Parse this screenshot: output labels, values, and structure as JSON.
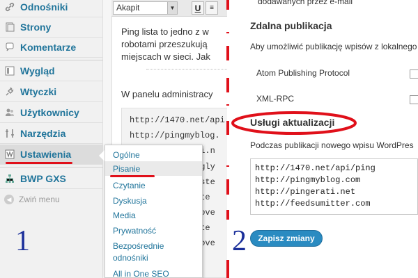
{
  "sidebar": {
    "items": [
      {
        "label": "Odnośniki",
        "icon": "link-icon"
      },
      {
        "label": "Strony",
        "icon": "pages-icon"
      },
      {
        "label": "Komentarze",
        "icon": "comments-icon"
      },
      {
        "label": "Wygląd",
        "icon": "appearance-icon"
      },
      {
        "label": "Wtyczki",
        "icon": "plugins-icon"
      },
      {
        "label": "Użytkownicy",
        "icon": "users-icon"
      },
      {
        "label": "Narzędzia",
        "icon": "tools-icon"
      },
      {
        "label": "Ustawienia",
        "icon": "settings-icon"
      },
      {
        "label": "BWP GXS",
        "icon": "sitemap-icon"
      }
    ],
    "collapse_label": "Zwiń menu"
  },
  "submenu": {
    "items": [
      "Ogólne",
      "Pisanie",
      "Czytanie",
      "Dyskusja",
      "Media",
      "Prywatność",
      "Bezpośrednie",
      "odnośniki",
      "All in One SEO"
    ]
  },
  "editor": {
    "format_value": "Akapit",
    "underline_button": "U",
    "para1": [
      "Ping lista to jedno z w",
      "robotami przeszukują",
      "miejscach w sieci. Jak"
    ],
    "para2": "W panelu administracy",
    "code_lines": [
      "http://1470.net/api",
      "http://pingmyblog.",
      "ti.n",
      "ogly",
      "lste",
      "ste",
      "eove",
      "ste",
      "eove"
    ]
  },
  "settings": {
    "top_text": "dodawanych przez e-mail",
    "remote_heading": "Zdalna publikacja",
    "remote_desc": "Aby umożliwić publikację wpisów z lokalnego",
    "atom_label": "Atom Publishing Protocol",
    "xmlrpc_label": "XML-RPC",
    "update_heading": "Usługi aktualizacji",
    "update_desc": "Podczas publikacji nowego wpisu WordPres",
    "ping_urls": [
      "http://1470.net/api/ping",
      "http://pingmyblog.com",
      "http://pingerati.net",
      "http://feedsumitter.com"
    ],
    "save_label": "Zapisz zmiany"
  },
  "annotations": {
    "step1": "1",
    "step2": "2",
    "highlight_color": "#e0101a"
  }
}
